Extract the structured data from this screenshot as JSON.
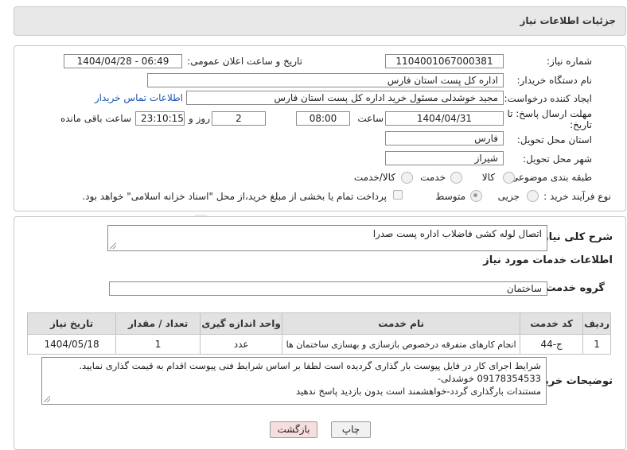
{
  "header": {
    "title": "جزئیات اطلاعات نیاز"
  },
  "form": {
    "need_number_label": "شماره نیاز:",
    "need_number": "1104001067000381",
    "announce_label": "تاریخ و ساعت اعلان عمومی:",
    "announce_value": "1404/04/28 - 06:49",
    "buyer_org_label": "نام دستگاه خریدار:",
    "buyer_org": "اداره کل پست استان فارس",
    "creator_label": "ایجاد کننده درخواست:",
    "creator": "مجید خوشدلی مسئول خرید اداره کل پست استان فارس",
    "contact_link": "اطلاعات تماس خریدار",
    "deadline_label": "مهلت ارسال پاسخ: تا تاریخ:",
    "deadline_date": "1404/04/31",
    "time_label": "ساعت",
    "deadline_time": "08:00",
    "days_value": "2",
    "days_label": "روز و",
    "remaining_time": "23:10:15",
    "remaining_label": "ساعت باقی مانده",
    "province_label": "استان محل تحویل:",
    "province": "فارس",
    "city_label": "شهر محل تحویل:",
    "city": "شیراز",
    "category_label": "طبقه بندی موضوعی:",
    "category_options": [
      "کالا",
      "خدمت",
      "کالا/خدمت"
    ],
    "category_selected": "خدمت",
    "process_label": "نوع فرآیند خرید :",
    "process_options": [
      "جزیی",
      "متوسط"
    ],
    "process_selected": "متوسط",
    "payment_note": "پرداخت تمام یا بخشی از مبلغ خرید،از محل \"اسناد خزانه اسلامی\" خواهد بود."
  },
  "summary": {
    "label": "شرح کلی نیاز:",
    "value": "اتصال لوله کشی فاضلاب اداره پست صدرا"
  },
  "services": {
    "section_title": "اطلاعات خدمات مورد نیاز",
    "group_label": "گروه خدمت:",
    "group_value": "ساختمان",
    "columns": [
      "ردیف",
      "کد خدمت",
      "نام خدمت",
      "واحد اندازه گیری",
      "تعداد / مقدار",
      "تاریخ نیاز"
    ],
    "rows": [
      [
        "1",
        "ج-44",
        "انجام کارهای متفرقه درخصوص بازسازی و بهسازی ساختمان ها",
        "عدد",
        "1",
        "1404/05/18"
      ]
    ]
  },
  "notes": {
    "label": "توضیحات خریدار:",
    "lines": [
      "شرایط اجرای کار در فایل پیوست بار گذاری گردیده است لطفا بر اساس شرایط فنی پیوست اقدام به قیمت گذاری نمایید.",
      "09178354533 خوشدلی-",
      "مستندات بارگذاری گردد-خواهشمند است  بدون بازدید پاسخ ندهید"
    ]
  },
  "buttons": {
    "print": "چاپ",
    "back": "بازگشت"
  },
  "watermark": {
    "text": "AriaTender.neT"
  },
  "colors": {
    "link": "#1a55b3",
    "back_button_bg": "#f7dede",
    "watermark": "#c0392b"
  }
}
